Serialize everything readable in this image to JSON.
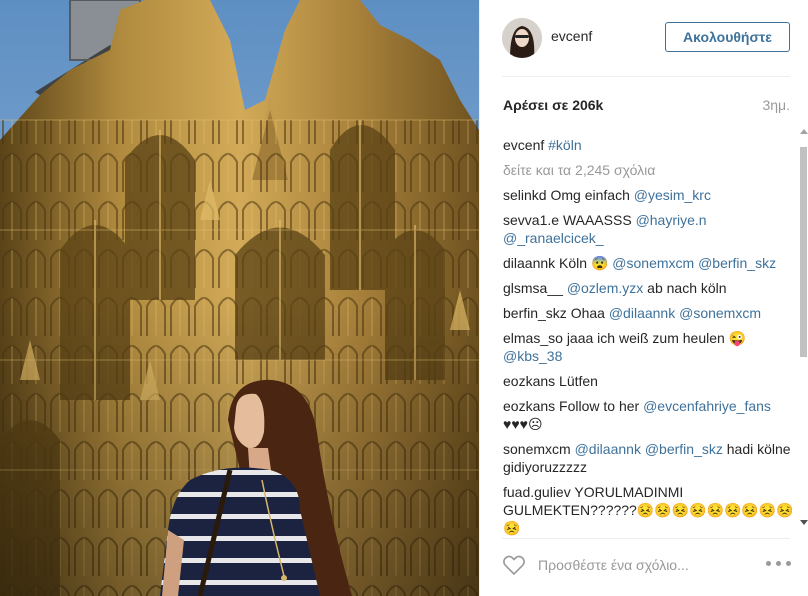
{
  "post": {
    "image_alt": "Woman in striped top in front of Cologne Cathedral",
    "colors": {
      "sky": "#6f9cc9",
      "stone": "#b08a3e",
      "link": "#3f729b",
      "muted": "#999999"
    }
  },
  "header": {
    "username": "evcenf",
    "follow_label": "Ακολουθήστε",
    "avatar_icon": "profile-avatar"
  },
  "stats": {
    "likes": "Αρέσει σε 206k",
    "time": "3ημ."
  },
  "caption": {
    "user": "evcenf",
    "text": "#köln"
  },
  "view_all": "δείτε και τα 2,245 σχόλια",
  "comments": [
    {
      "user": "selinkd",
      "parts": [
        {
          "t": "Omg einfach "
        },
        {
          "l": "@yesim_krc"
        }
      ]
    },
    {
      "user": "sevva1.e",
      "parts": [
        {
          "t": "WAAASSS "
        },
        {
          "l": "@hayriye.n"
        },
        {
          "t": " "
        },
        {
          "l": "@_ranaelcicek_"
        }
      ]
    },
    {
      "user": "dilaannk",
      "parts": [
        {
          "t": "Köln 😨 "
        },
        {
          "l": "@sonemxcm"
        },
        {
          "t": " "
        },
        {
          "l": "@berfin_skz"
        }
      ]
    },
    {
      "user": "glsmsa__",
      "parts": [
        {
          "l": "@ozlem.yzx"
        },
        {
          "t": " ab nach köln"
        }
      ]
    },
    {
      "user": "berfin_skz",
      "parts": [
        {
          "t": "Ohaa "
        },
        {
          "l": "@dilaannk"
        },
        {
          "t": " "
        },
        {
          "l": "@sonemxcm"
        }
      ]
    },
    {
      "user": "elmas_so",
      "parts": [
        {
          "t": "jaaa ich weiß zum heulen 😜 "
        },
        {
          "l": "@kbs_38"
        }
      ]
    },
    {
      "user": "eozkans",
      "parts": [
        {
          "t": "Lütfen"
        }
      ]
    },
    {
      "user": "eozkans",
      "parts": [
        {
          "t": "Follow to her "
        },
        {
          "l": "@evcenfahriye_fans"
        },
        {
          "t": " ♥♥♥☹"
        }
      ]
    },
    {
      "user": "sonemxcm",
      "parts": [
        {
          "l": "@dilaannk"
        },
        {
          "t": " "
        },
        {
          "l": "@berfin_skz"
        },
        {
          "t": " hadi kölne gidiyoruzzzzz"
        }
      ]
    },
    {
      "user": "fuad.guliev",
      "parts": [
        {
          "t": "YORULMADINMI GULMEKTEN??????😣😣😣😣😣😣😣😣😣😣"
        }
      ]
    }
  ],
  "footer": {
    "comment_placeholder": "Προσθέστε ένα σχόλιο...",
    "like_icon": "heart-icon",
    "more_icon": "more-options-icon"
  }
}
